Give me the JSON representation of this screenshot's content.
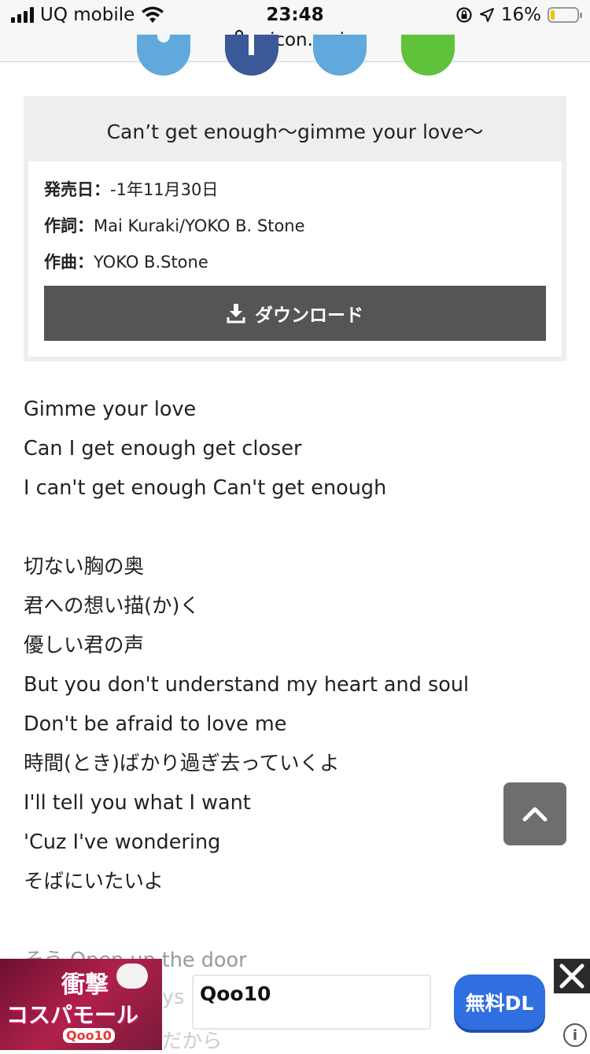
{
  "status_bar": {
    "carrier": "UQ mobile",
    "time": "23:48",
    "battery": "16%",
    "battery_level": 0.16,
    "url": "oricon.co.jp"
  },
  "share_buttons": [
    {
      "name": "share-twitter",
      "color": "#5fa9dd"
    },
    {
      "name": "share-facebook",
      "color": "#3b5998"
    },
    {
      "name": "share-hatena",
      "color": "#5fa9dd"
    },
    {
      "name": "share-line",
      "color": "#5ec23a"
    }
  ],
  "song": {
    "title": "Can’t get enough〜gimme your love〜",
    "release_label": "発売日：",
    "release_value": "-1年11月30日",
    "lyricist_label": "作詞：",
    "lyricist_value": "Mai Kuraki/YOKO B. Stone",
    "composer_label": "作曲：",
    "composer_value": "YOKO B.Stone",
    "download_label": "ダウンロード"
  },
  "lyrics": [
    "Gimme your love",
    "Can I get enough get closer",
    "I can't get enough Can't get enough",
    "",
    "切ない胸の奥",
    "君への想い描(か)く",
    "優しい君の声",
    "But you don't understand my heart and soul",
    "Don't be afraid to love me",
    "時間(とき)ばかり過ぎ去っていくよ",
    "I'll tell you what I want",
    "'Cuz I've wondering",
    "そばにいたいよ",
    "",
    "そう Open up the door"
  ],
  "ad": {
    "banner_line1": "衝撃",
    "banner_line2": "コスパモール",
    "banner_brand": "Qoo10",
    "field_text": "Qoo10",
    "button_label": "無料DL",
    "under_text_1": "ys",
    "under_text_2": "だから",
    "info": "i"
  }
}
